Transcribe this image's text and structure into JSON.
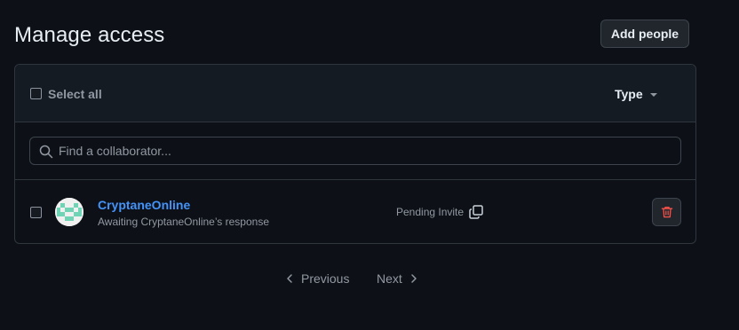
{
  "header": {
    "title": "Manage access",
    "add_people_label": "Add people"
  },
  "toolbar": {
    "select_all_label": "Select all",
    "type_label": "Type"
  },
  "search": {
    "placeholder": "Find a collaborator..."
  },
  "members": [
    {
      "name": "CryptaneOnline",
      "subtitle": "Awaiting CryptaneOnline’s response",
      "status": "Pending Invite",
      "avatar_icon": "identicon"
    }
  ],
  "pagination": {
    "previous_label": "Previous",
    "next_label": "Next"
  },
  "colors": {
    "background": "#0d1117",
    "link": "#4493f8",
    "danger": "#f85149",
    "avatar_fill": "#6fd3b5"
  }
}
